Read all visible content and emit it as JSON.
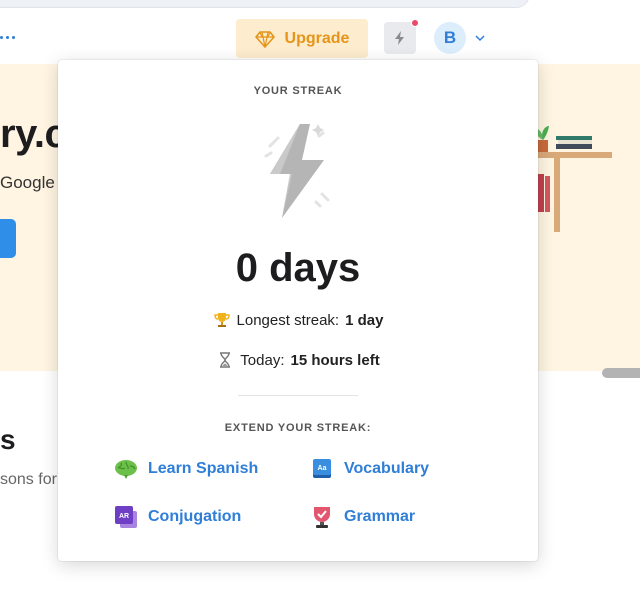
{
  "header": {
    "upgrade_label": "Upgrade",
    "avatar_initial": "B"
  },
  "background": {
    "hero_title": "ry.c",
    "hero_subtitle": "Google",
    "section_title": "s",
    "section_subtitle": "sons for"
  },
  "popup": {
    "heading": "YOUR STREAK",
    "days": "0 days",
    "longest_label": "Longest streak:",
    "longest_value": "1 day",
    "today_label": "Today:",
    "today_value": "15 hours left",
    "extend_heading": "EXTEND YOUR STREAK:",
    "links": [
      {
        "label": "Learn Spanish",
        "icon": "brain-icon"
      },
      {
        "label": "Vocabulary",
        "icon": "dictionary-icon"
      },
      {
        "label": "Conjugation",
        "icon": "ar-cards-icon"
      },
      {
        "label": "Grammar",
        "icon": "trophy-cup-icon"
      }
    ]
  },
  "colors": {
    "accent_blue": "#2f7ed8",
    "upgrade_orange": "#e5951a",
    "upgrade_bg": "#fdeccd",
    "notification_dot": "#e94a66",
    "hero_bg": "#fff5e2"
  }
}
